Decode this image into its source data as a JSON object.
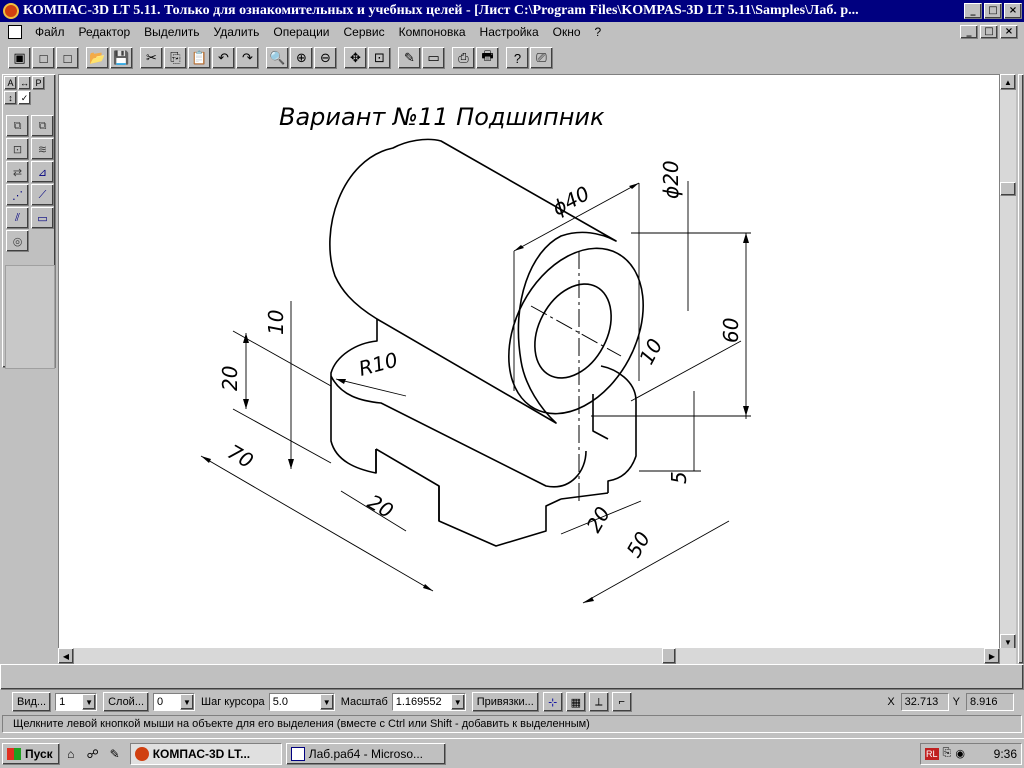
{
  "window": {
    "title": "КОМПАС-3D LT 5.11. Только для ознакомительных и учебных целей - [Лист C:\\Program Files\\KOMPAS-3D LT 5.11\\Samples\\Лаб. р...",
    "min_glyph": "_",
    "max_glyph": "□",
    "close_glyph": "×"
  },
  "menu": {
    "items": [
      "Файл",
      "Редактор",
      "Выделить",
      "Удалить",
      "Операции",
      "Сервис",
      "Компоновка",
      "Настройка",
      "Окно",
      "?"
    ]
  },
  "toolbar": {
    "icons": [
      "▣",
      "□",
      "□",
      "📂",
      "💾",
      "✂",
      "⎘",
      "📋",
      "↶",
      "↷",
      "🔍",
      "⊕",
      "⊖",
      "✥",
      "⊡",
      "✎",
      "▭",
      "⎙",
      "🖶",
      "?",
      "⎚"
    ]
  },
  "left_panel": {
    "tabs": [
      "А",
      "↔",
      "Р",
      "↕",
      "✓"
    ],
    "tools": [
      "⧉",
      "⧉",
      "⊡",
      "≋",
      "⇄",
      "⊿",
      "⋰",
      "⟋",
      "⫽",
      "▭",
      "◎"
    ]
  },
  "drawing": {
    "title": "Вариант №11 Подшипник",
    "dims": {
      "d40": "ϕ40",
      "d20": "ϕ20",
      "v60": "60",
      "v10a": "10",
      "v20": "20",
      "r10": "R10",
      "v10b": "10",
      "v70": "70",
      "v20b": "20",
      "v20c": "20",
      "v50": "50",
      "v5": "5"
    }
  },
  "props": {
    "view_btn": "Вид...",
    "view_val": "1",
    "layer_btn": "Слой...",
    "layer_val": "0",
    "step_label": "Шаг курсора",
    "step_val": "5.0",
    "scale_label": "Масштаб",
    "scale_val": "1.169552",
    "snap_btn": "Привязки...",
    "x_label": "X",
    "x_val": "32.713",
    "y_label": "Y",
    "y_val": "8.916"
  },
  "status": {
    "message": "Щелкните левой кнопкой мыши на объекте для его выделения (вместе с Ctrl или Shift - добавить к выделенным)"
  },
  "taskbar": {
    "start": "Пуск",
    "tasks": [
      {
        "label": "КОМПАС-3D LT...",
        "active": true
      },
      {
        "label": "Лаб.раб4 - Microso...",
        "active": false
      }
    ],
    "lang": "RL",
    "time": "9:36"
  }
}
